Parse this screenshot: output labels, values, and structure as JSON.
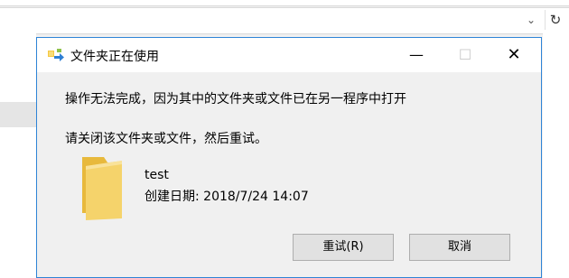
{
  "background": {
    "address_dropdown_icon": "chevron-down",
    "refresh_icon": "refresh"
  },
  "dialog": {
    "title": "文件夹正在使用",
    "message": "操作无法完成，因为其中的文件夹或文件已在另一程序中打开",
    "instruction": "请关闭该文件夹或文件，然后重试。",
    "file": {
      "name": "test",
      "created": "创建日期: 2018/7/24 14:07"
    },
    "buttons": {
      "retry": "重试(R)",
      "cancel": "取消"
    },
    "window_controls": {
      "minimize": "—",
      "maximize": "☐",
      "close": "✕"
    }
  },
  "colors": {
    "dialog_border": "#2e84d6",
    "folder_yellow": "#f5d36b"
  }
}
